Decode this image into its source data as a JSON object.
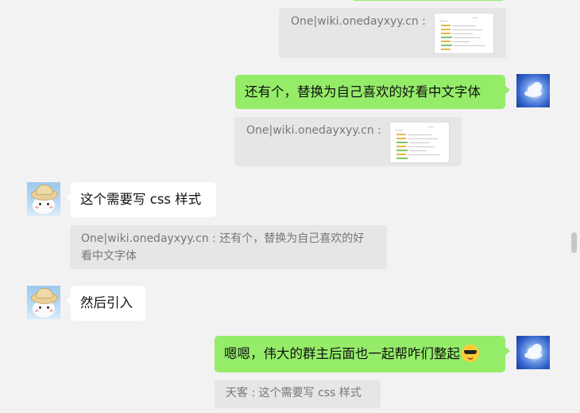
{
  "chat": {
    "messages": [
      {
        "side": "right",
        "avatar": "sky-clouds-avatar",
        "text": "还有个，替换为自己喜欢的好看中文字体"
      },
      {
        "side": "left",
        "avatar": "hat-girl-avatar",
        "text": "这个需要写 css 样式"
      },
      {
        "side": "left",
        "avatar": "hat-girl-avatar",
        "text": "然后引入"
      },
      {
        "side": "right",
        "avatar": "sky-clouds-avatar",
        "text": "嗯嗯，伟大的群主后面也一起帮咋们整起",
        "emoji": "sunglasses-emoji"
      }
    ],
    "quotes": [
      {
        "label": "One|wiki.onedayxyy.cn :",
        "has_image": true
      },
      {
        "label": "One|wiki.onedayxyy.cn :",
        "has_image": true
      },
      {
        "label_line1": "One|wiki.onedayxyy.cn : 还有个，替换为自己喜欢的好",
        "label_line2": "看中文字体"
      },
      {
        "label": "天客 : 这个需要写 css 样式"
      }
    ]
  },
  "colors": {
    "background": "#f2f2f2",
    "bubble_self": "#95ec69",
    "bubble_other": "#ffffff",
    "quote_bg": "#e6e6e6"
  }
}
